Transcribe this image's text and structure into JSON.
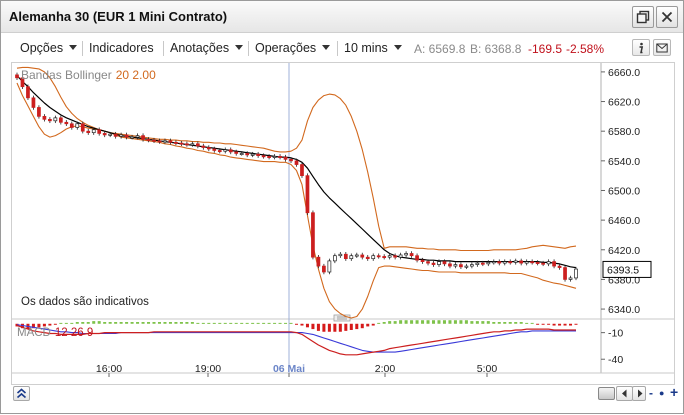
{
  "window": {
    "title": "Alemanha 30 (EUR 1 Mini Contrato)",
    "buttons": [
      {
        "name": "restore-window-button",
        "icon": "restore-window-icon"
      },
      {
        "name": "close-window-button",
        "icon": "close-icon"
      }
    ]
  },
  "toolbar": {
    "options_label": "Opções",
    "indicators_label": "Indicadores",
    "annotations_label": "Anotações",
    "operations_label": "Operações",
    "interval_label": "10 mins",
    "ask": "A: 6569.8",
    "bid": "B: 6368.8",
    "change": "-169.5",
    "change_pct": "-2.58%",
    "info_icon": "info-icon",
    "mail_icon": "envelope-icon"
  },
  "indicator_legend": {
    "name": "Bandas Bollinger",
    "params": "20  2.00"
  },
  "notice": "Os dados são indicativos",
  "macd_legend": {
    "name": "MACD",
    "params": "12  26  9"
  },
  "colors": {
    "up": "#1a7f1a",
    "down": "#cc1f1f",
    "bollinger": "#d2691e",
    "sma": "#000000",
    "macd_line": "#cc1f1f",
    "signal_line": "#3a3ad8",
    "hist_pos": "#7ec24a",
    "hist_neg": "#d61a1a",
    "crosshair": "#9fb0d8",
    "current_price_box": "#000000"
  },
  "bottom_bar": {
    "collapse_icon": "double-chevron-up-icon",
    "back_icon": "chevron-left-icon",
    "forward_icon": "chevron-right-icon",
    "zoom_out": "-",
    "zoom_dot": "●",
    "zoom_in": "+"
  },
  "chart_data": [
    {
      "type": "candlestick",
      "title": "",
      "series_labels": [
        "Bandas Bollinger 20 2.00"
      ],
      "x_ticks": [
        "16:00",
        "19:00",
        "06 Mai",
        "2:00",
        "5:00"
      ],
      "y_ticks": [
        6660.0,
        6620.0,
        6580.0,
        6540.0,
        6500.0,
        6460.0,
        6420.0,
        6380.0,
        6340.0
      ],
      "y_tick_labels": [
        "6660.0",
        "6620.0",
        "6580.0",
        "6540.0",
        "6500.0",
        "6460.0",
        "6420.0",
        "6380.0",
        "6340.0"
      ],
      "ylim": [
        6332,
        6672
      ],
      "current_price": "6393.5",
      "crosshair_at": "06 Mai",
      "close": [
        6652,
        6640,
        6625,
        6612,
        6600,
        6596,
        6594,
        6598,
        6592,
        6590,
        6585,
        6590,
        6580,
        6578,
        6582,
        6577,
        6575,
        6576,
        6573,
        6575,
        6572,
        6572,
        6574,
        6569,
        6568,
        6567,
        6566,
        6567,
        6565,
        6564,
        6563,
        6562,
        6563,
        6560,
        6558,
        6556,
        6554,
        6553,
        6555,
        6552,
        6550,
        6550,
        6548,
        6549,
        6547,
        6546,
        6545,
        6546,
        6545,
        6542,
        6540,
        6535,
        6520,
        6470,
        6410,
        6398,
        6390,
        6405,
        6412,
        6414,
        6408,
        6412,
        6413,
        6410,
        6408,
        6412,
        6411,
        6410,
        6412,
        6410,
        6413,
        6415,
        6412,
        6406,
        6404,
        6402,
        6400,
        6404,
        6401,
        6398,
        6400,
        6397,
        6398,
        6400,
        6402,
        6401,
        6403,
        6404,
        6402,
        6404,
        6403,
        6405,
        6402,
        6404,
        6403,
        6402,
        6401,
        6404,
        6398,
        6396,
        6380,
        6382,
        6394
      ],
      "sma": [
        6655,
        6647,
        6640,
        6632,
        6625,
        6618,
        6612,
        6607,
        6602,
        6598,
        6595,
        6592,
        6589,
        6586,
        6584,
        6582,
        6580,
        6578,
        6576,
        6574,
        6573,
        6572,
        6571,
        6570,
        6569,
        6568,
        6567,
        6566,
        6565,
        6564,
        6563,
        6562,
        6561,
        6560,
        6559,
        6558,
        6557,
        6556,
        6555,
        6554,
        6553,
        6552,
        6551,
        6550,
        6549,
        6548,
        6547,
        6546,
        6545,
        6545,
        6544,
        6542,
        6538,
        6530,
        6519,
        6508,
        6498,
        6490,
        6483,
        6476,
        6469,
        6462,
        6455,
        6448,
        6441,
        6434,
        6427,
        6420,
        6415,
        6412,
        6410,
        6409,
        6408,
        6407,
        6407,
        6406,
        6406,
        6405,
        6405,
        6405,
        6404,
        6404,
        6404,
        6404,
        6404,
        6404,
        6404,
        6404,
        6404,
        6404,
        6404,
        6404,
        6404,
        6404,
        6404,
        6404,
        6403,
        6403,
        6402,
        6401,
        6399,
        6397,
        6396
      ],
      "bb_upper": [
        6665,
        6666,
        6666,
        6665,
        6664,
        6660,
        6652,
        6640,
        6626,
        6613,
        6604,
        6597,
        6592,
        6588,
        6585,
        6582,
        6580,
        6578,
        6577,
        6576,
        6575,
        6574,
        6573,
        6572,
        6571,
        6570,
        6569,
        6569,
        6568,
        6568,
        6567,
        6567,
        6566,
        6566,
        6565,
        6565,
        6564,
        6564,
        6563,
        6563,
        6562,
        6561,
        6560,
        6559,
        6558,
        6557,
        6555,
        6553,
        6552,
        6552,
        6553,
        6557,
        6568,
        6594,
        6612,
        6622,
        6628,
        6630,
        6629,
        6624,
        6615,
        6600,
        6580,
        6555,
        6525,
        6490,
        6452,
        6422,
        6424,
        6424,
        6424,
        6424,
        6423,
        6422,
        6422,
        6421,
        6421,
        6420,
        6420,
        6420,
        6420,
        6419,
        6419,
        6419,
        6419,
        6419,
        6419,
        6420,
        6420,
        6420,
        6420,
        6420,
        6421,
        6422,
        6424,
        6425,
        6426,
        6425,
        6424,
        6423,
        6422,
        6424,
        6425
      ],
      "bb_lower": [
        6645,
        6628,
        6614,
        6600,
        6586,
        6576,
        6572,
        6574,
        6578,
        6583,
        6586,
        6587,
        6586,
        6584,
        6583,
        6582,
        6580,
        6578,
        6575,
        6572,
        6571,
        6570,
        6569,
        6568,
        6567,
        6566,
        6565,
        6563,
        6562,
        6560,
        6559,
        6557,
        6556,
        6554,
        6553,
        6551,
        6550,
        6548,
        6547,
        6545,
        6544,
        6543,
        6542,
        6541,
        6540,
        6539,
        6539,
        6539,
        6538,
        6538,
        6535,
        6527,
        6508,
        6466,
        6426,
        6394,
        6368,
        6350,
        6340,
        6334,
        6330,
        6328,
        6330,
        6340,
        6357,
        6378,
        6396,
        6398,
        6398,
        6397,
        6396,
        6395,
        6394,
        6393,
        6392,
        6392,
        6391,
        6390,
        6390,
        6390,
        6390,
        6389,
        6389,
        6389,
        6389,
        6389,
        6389,
        6389,
        6389,
        6389,
        6388,
        6388,
        6388,
        6386,
        6384,
        6382,
        6379,
        6377,
        6375,
        6374,
        6372,
        6370,
        6368
      ]
    },
    {
      "type": "line",
      "title": "",
      "series_labels": [
        "MACD 12 26 9"
      ],
      "y_ticks": [
        -10,
        -40
      ],
      "y_tick_labels": [
        "-10",
        "-40"
      ],
      "ylim": [
        -42,
        2
      ],
      "macd": [
        -2,
        -4,
        -6,
        -8,
        -9,
        -10,
        -11,
        -11,
        -12,
        -12,
        -12,
        -12,
        -12,
        -11,
        -11,
        -11,
        -10,
        -10,
        -10,
        -10,
        -10,
        -10,
        -10,
        -10,
        -10,
        -9,
        -9,
        -9,
        -9,
        -9,
        -9,
        -9,
        -9,
        -9,
        -9,
        -9,
        -9,
        -9,
        -9,
        -9,
        -9,
        -9,
        -9,
        -9,
        -9,
        -9,
        -9,
        -9,
        -9,
        -9,
        -9,
        -10,
        -12,
        -16,
        -20,
        -24,
        -27,
        -30,
        -32,
        -34,
        -35,
        -35,
        -35,
        -34,
        -33,
        -32,
        -31,
        -30,
        -28,
        -27,
        -26,
        -25,
        -24,
        -23,
        -22,
        -21,
        -20,
        -19,
        -18,
        -17,
        -16,
        -15,
        -14,
        -13,
        -12,
        -11,
        -10,
        -9,
        -9,
        -8,
        -8,
        -7,
        -7,
        -6,
        -6,
        -6,
        -6,
        -6,
        -7,
        -7,
        -7,
        -7,
        -7
      ],
      "signal": [
        -1,
        -2,
        -3,
        -4,
        -5,
        -6,
        -7,
        -8,
        -9,
        -9,
        -10,
        -10,
        -11,
        -11,
        -11,
        -11,
        -11,
        -11,
        -11,
        -10,
        -10,
        -10,
        -10,
        -10,
        -10,
        -10,
        -10,
        -10,
        -10,
        -10,
        -10,
        -10,
        -10,
        -10,
        -10,
        -10,
        -10,
        -10,
        -10,
        -10,
        -10,
        -10,
        -10,
        -10,
        -10,
        -10,
        -10,
        -10,
        -10,
        -10,
        -10,
        -10,
        -10,
        -11,
        -12,
        -14,
        -16,
        -18,
        -20,
        -22,
        -24,
        -26,
        -28,
        -30,
        -31,
        -32,
        -32,
        -32,
        -32,
        -32,
        -31,
        -30,
        -29,
        -28,
        -27,
        -26,
        -25,
        -24,
        -23,
        -22,
        -21,
        -20,
        -19,
        -18,
        -17,
        -16,
        -15,
        -14,
        -13,
        -12,
        -11,
        -10,
        -9,
        -9,
        -8,
        -8,
        -8,
        -8,
        -8,
        -8,
        -8,
        -8,
        -8
      ],
      "histogram": [
        -3,
        -5,
        -6,
        -5,
        -4,
        -3,
        -2,
        -1,
        1,
        1,
        1,
        2,
        2,
        2,
        3,
        3,
        2,
        2,
        2,
        2,
        2,
        2,
        2,
        2,
        2,
        2,
        2,
        2,
        2,
        2,
        2,
        2,
        2,
        1,
        1,
        1,
        1,
        1,
        1,
        1,
        1,
        1,
        1,
        1,
        1,
        1,
        1,
        1,
        1,
        1,
        1,
        -1,
        -2,
        -4,
        -6,
        -8,
        -9,
        -9,
        -9,
        -9,
        -8,
        -7,
        -6,
        -5,
        -3,
        -2,
        1,
        2,
        3,
        3,
        4,
        4,
        4,
        4,
        4,
        4,
        4,
        4,
        4,
        4,
        4,
        4,
        4,
        3,
        3,
        3,
        3,
        2,
        2,
        2,
        2,
        2,
        2,
        1,
        1,
        -1,
        -1,
        -1,
        -2,
        -2,
        -2,
        -2,
        -1
      ]
    }
  ]
}
